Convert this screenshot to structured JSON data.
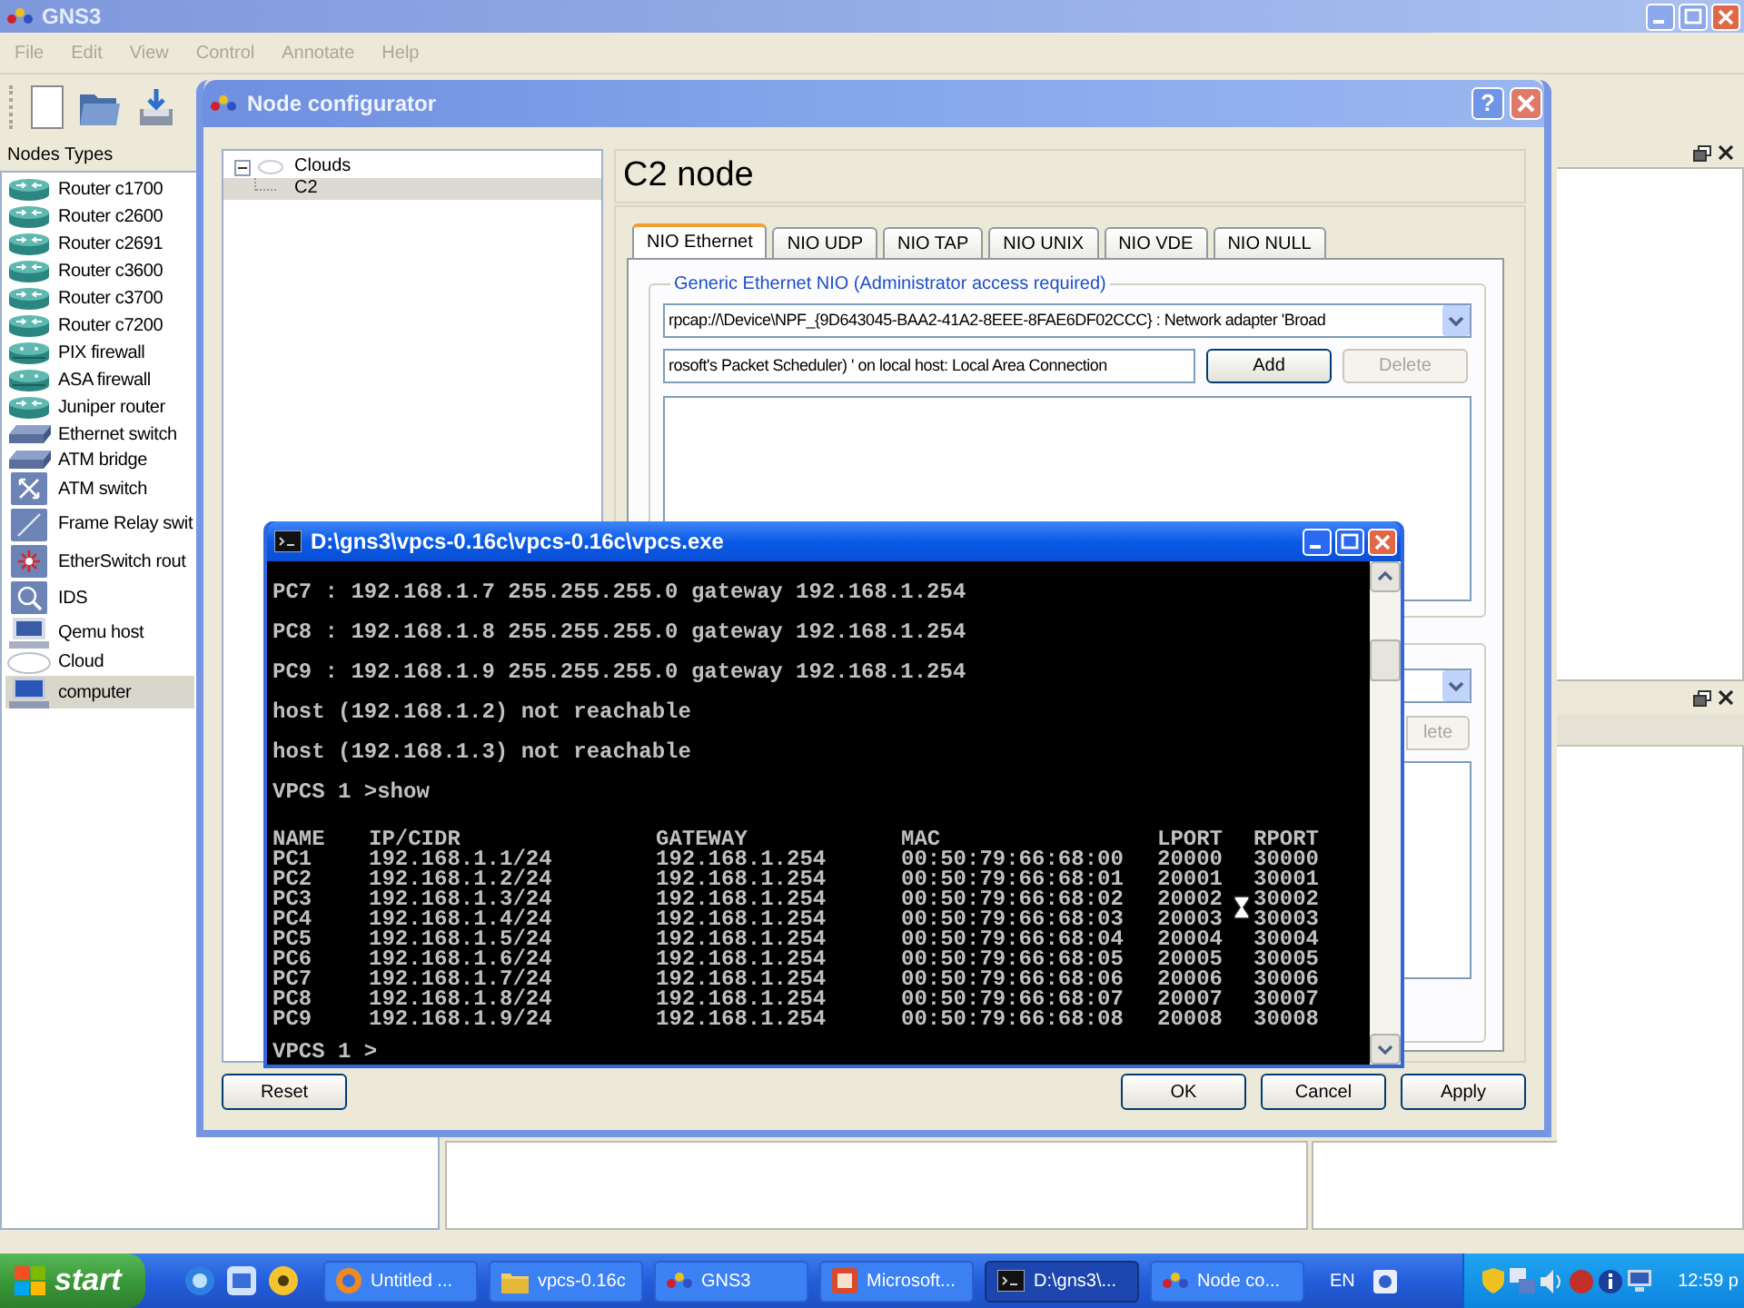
{
  "gns3_window": {
    "title": "GNS3",
    "menu": [
      {
        "label": "File",
        "disabled": true
      },
      {
        "label": "Edit",
        "disabled": true
      },
      {
        "label": "View",
        "disabled": true
      },
      {
        "label": "Control",
        "disabled": true
      },
      {
        "label": "Annotate",
        "disabled": true
      },
      {
        "label": "Help",
        "disabled": true
      }
    ],
    "nodes_panel": {
      "title": "Nodes Types",
      "items": [
        {
          "label": "Router c1700",
          "kind": "router",
          "selected": false
        },
        {
          "label": "Router c2600",
          "kind": "router",
          "selected": false
        },
        {
          "label": "Router c2691",
          "kind": "router",
          "selected": false
        },
        {
          "label": "Router c3600",
          "kind": "router",
          "selected": false
        },
        {
          "label": "Router c3700",
          "kind": "router",
          "selected": false
        },
        {
          "label": "Router c7200",
          "kind": "router",
          "selected": false
        },
        {
          "label": "PIX firewall",
          "kind": "firewall",
          "selected": false
        },
        {
          "label": "ASA firewall",
          "kind": "firewall",
          "selected": false
        },
        {
          "label": "Juniper router",
          "kind": "router",
          "selected": false
        },
        {
          "label": "Ethernet switch",
          "kind": "switch",
          "selected": false
        },
        {
          "label": "ATM bridge",
          "kind": "switch",
          "selected": false
        },
        {
          "label": "ATM switch",
          "kind": "atm_switch",
          "selected": false
        },
        {
          "label": "Frame Relay swit",
          "kind": "frame_relay",
          "selected": false
        },
        {
          "label": "EtherSwitch rout",
          "kind": "etherswitch",
          "selected": false
        },
        {
          "label": "IDS",
          "kind": "ids",
          "selected": false
        },
        {
          "label": "Qemu host",
          "kind": "host",
          "selected": false
        },
        {
          "label": "Cloud",
          "kind": "cloud",
          "selected": false
        },
        {
          "label": "computer",
          "kind": "computer",
          "selected": true
        }
      ]
    }
  },
  "node_configurator": {
    "title": "Node configurator",
    "help_label": "?",
    "tree": [
      {
        "label": "Clouds",
        "expanded": true,
        "selected": false,
        "children": [
          {
            "label": "C2",
            "selected": true
          }
        ]
      }
    ],
    "header": "C2 node",
    "tabs": [
      {
        "label": "NIO Ethernet",
        "selected": true
      },
      {
        "label": "NIO UDP",
        "selected": false
      },
      {
        "label": "NIO TAP",
        "selected": false
      },
      {
        "label": "NIO UNIX",
        "selected": false
      },
      {
        "label": "NIO VDE",
        "selected": false
      },
      {
        "label": "NIO NULL",
        "selected": false
      }
    ],
    "generic_nio": {
      "title": "Generic Ethernet NIO (Administrator access required)",
      "adapter": "rpcap://\\Device\\NPF_{9D643045-BAA2-41A2-8EEE-8FAE6DF02CCC} : Network adapter 'Broad",
      "interface": "rosoft's Packet Scheduler) ' on local host: Local Area Connection",
      "buttons": [
        {
          "label": "Add",
          "disabled": false
        },
        {
          "label": "Delete",
          "disabled": true
        }
      ]
    },
    "second_group": {
      "buttons": [
        {
          "label": "lete",
          "disabled": true
        }
      ]
    },
    "buttons": [
      "Reset",
      "OK",
      "Cancel",
      "Apply"
    ]
  },
  "console": {
    "title": "D:\\gns3\\vpcs-0.16c\\vpcs-0.16c\\vpcs.exe",
    "lines": [
      "PC7 : 192.168.1.7 255.255.255.0 gateway 192.168.1.254",
      "PC8 : 192.168.1.8 255.255.255.0 gateway 192.168.1.254",
      "PC9 : 192.168.1.9 255.255.255.0 gateway 192.168.1.254",
      "host (192.168.1.2) not reachable",
      "host (192.168.1.3) not reachable",
      "VPCS 1 >show"
    ],
    "table": {
      "columns": [
        "NAME",
        "IP/CIDR",
        "GATEWAY",
        "MAC",
        "LPORT",
        "RPORT"
      ],
      "rows": [
        [
          "PC1",
          "192.168.1.1/24",
          "192.168.1.254",
          "00:50:79:66:68:00",
          "20000",
          "30000"
        ],
        [
          "PC2",
          "192.168.1.2/24",
          "192.168.1.254",
          "00:50:79:66:68:01",
          "20001",
          "30001"
        ],
        [
          "PC3",
          "192.168.1.3/24",
          "192.168.1.254",
          "00:50:79:66:68:02",
          "20002",
          "30002"
        ],
        [
          "PC4",
          "192.168.1.4/24",
          "192.168.1.254",
          "00:50:79:66:68:03",
          "20003",
          "30003"
        ],
        [
          "PC5",
          "192.168.1.5/24",
          "192.168.1.254",
          "00:50:79:66:68:04",
          "20004",
          "30004"
        ],
        [
          "PC6",
          "192.168.1.6/24",
          "192.168.1.254",
          "00:50:79:66:68:05",
          "20005",
          "30005"
        ],
        [
          "PC7",
          "192.168.1.7/24",
          "192.168.1.254",
          "00:50:79:66:68:06",
          "20006",
          "30006"
        ],
        [
          "PC8",
          "192.168.1.8/24",
          "192.168.1.254",
          "00:50:79:66:68:07",
          "20007",
          "30007"
        ],
        [
          "PC9",
          "192.168.1.9/24",
          "192.168.1.254",
          "00:50:79:66:68:08",
          "20008",
          "30008"
        ]
      ]
    },
    "prompt": "VPCS 1 >"
  },
  "taskbar": {
    "start": "start",
    "tasks": [
      {
        "label": "Untitled ...",
        "kind": "browser",
        "selected": false
      },
      {
        "label": "vpcs-0.16c",
        "kind": "folder",
        "selected": false
      },
      {
        "label": "GNS3",
        "kind": "gns3",
        "selected": false
      },
      {
        "label": "Microsoft...",
        "kind": "office",
        "selected": false
      },
      {
        "label": "D:\\gns3\\...",
        "kind": "console",
        "selected": true
      },
      {
        "label": "Node co...",
        "kind": "gns3",
        "selected": false
      }
    ],
    "language": "EN",
    "clock": "12:59 p"
  }
}
